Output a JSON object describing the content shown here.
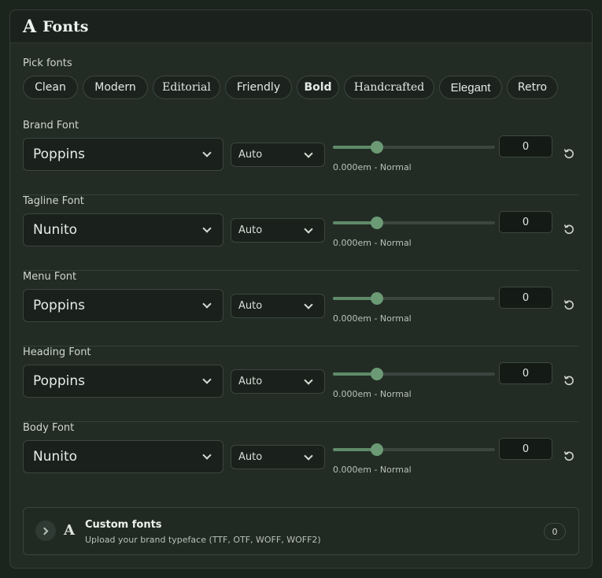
{
  "header": {
    "icon": "font-icon",
    "icon_glyph": "A",
    "title": "Fonts"
  },
  "picker": {
    "label": "Pick fonts",
    "options": [
      "Clean",
      "Modern",
      "Editorial",
      "Friendly",
      "Bold",
      "Handcrafted",
      "Elegant",
      "Retro"
    ]
  },
  "rows": [
    {
      "label": "Brand Font",
      "font": "Poppins",
      "weight": "Auto",
      "spacing_value": "0",
      "spacing_hint": "0.000em - Normal",
      "slider_fraction": 0.27
    },
    {
      "label": "Tagline Font",
      "font": "Nunito",
      "weight": "Auto",
      "spacing_value": "0",
      "spacing_hint": "0.000em - Normal",
      "slider_fraction": 0.27
    },
    {
      "label": "Menu Font",
      "font": "Poppins",
      "weight": "Auto",
      "spacing_value": "0",
      "spacing_hint": "0.000em - Normal",
      "slider_fraction": 0.27
    },
    {
      "label": "Heading Font",
      "font": "Poppins",
      "weight": "Auto",
      "spacing_value": "0",
      "spacing_hint": "0.000em - Normal",
      "slider_fraction": 0.27
    },
    {
      "label": "Body Font",
      "font": "Nunito",
      "weight": "Auto",
      "spacing_value": "0",
      "spacing_hint": "0.000em - Normal",
      "slider_fraction": 0.27
    }
  ],
  "custom_fonts": {
    "icon_glyph": "A",
    "title": "Custom fonts",
    "subtitle": "Upload your brand typeface (TTF, OTF, WOFF, WOFF2)",
    "count": "0"
  },
  "colors": {
    "accent": "#6b9a74",
    "background": "#222c25"
  }
}
